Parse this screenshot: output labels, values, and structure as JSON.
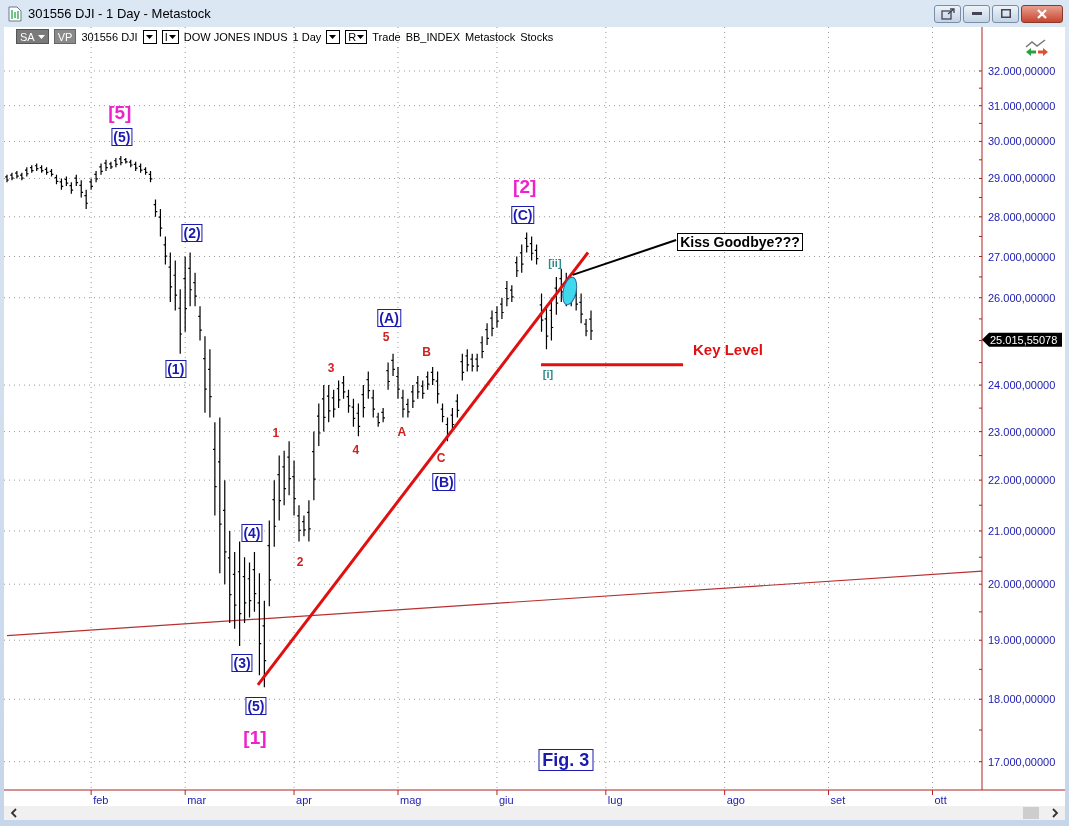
{
  "window": {
    "title": "301556 DJI - 1 Day - Metastock"
  },
  "toolbar": [
    {
      "kind": "combo",
      "label": "SA"
    },
    {
      "kind": "chip",
      "label": "VP"
    },
    {
      "kind": "text",
      "label": "301556 DJI"
    },
    {
      "kind": "dropdown"
    },
    {
      "kind": "dropdown",
      "label": "I"
    },
    {
      "kind": "text",
      "label": "DOW JONES INDUS"
    },
    {
      "kind": "text",
      "label": "1 Day"
    },
    {
      "kind": "dropdown"
    },
    {
      "kind": "dropdown",
      "label": "R"
    },
    {
      "kind": "text",
      "label": "Trade"
    },
    {
      "kind": "text",
      "label": "BB_INDEX"
    },
    {
      "kind": "text",
      "label": "Metastock"
    },
    {
      "kind": "text",
      "label": "Stocks"
    }
  ],
  "chart": {
    "last_price_label": "25.015,55078",
    "y_axis_labels": [
      "32.000,00000",
      "31.000,00000",
      "30.000,00000",
      "29.000,00000",
      "28.000,00000",
      "27.000,00000",
      "26.000,00000",
      "24.000,00000",
      "23.000,00000",
      "22.000,00000",
      "21.000,00000",
      "20.000,00000",
      "19.000,00000",
      "18.000,00000",
      "17.000,00000"
    ],
    "x_axis_labels": [
      "feb",
      "mar",
      "apr",
      "mag",
      "giu",
      "lug",
      "ago",
      "set",
      "ott"
    ],
    "wave_labels": [
      {
        "kind": "major",
        "text": "[5]"
      },
      {
        "kind": "boxed",
        "text": "(5)"
      },
      {
        "kind": "boxed",
        "text": "(2)"
      },
      {
        "kind": "boxed",
        "text": "(1)"
      },
      {
        "kind": "boxed",
        "text": "(4)"
      },
      {
        "kind": "boxed",
        "text": "(3)"
      },
      {
        "kind": "boxed",
        "text": "(5)"
      },
      {
        "kind": "major",
        "text": "[1]"
      },
      {
        "kind": "minor",
        "text": "1"
      },
      {
        "kind": "minor",
        "text": "2"
      },
      {
        "kind": "minor",
        "text": "3"
      },
      {
        "kind": "minor",
        "text": "4"
      },
      {
        "kind": "minor",
        "text": "5"
      },
      {
        "kind": "boxed",
        "text": "(A)"
      },
      {
        "kind": "minor",
        "text": "A"
      },
      {
        "kind": "minor",
        "text": "B"
      },
      {
        "kind": "minor",
        "text": "C"
      },
      {
        "kind": "boxed",
        "text": "(B)"
      },
      {
        "kind": "major",
        "text": "[2]"
      },
      {
        "kind": "boxed",
        "text": "(C)"
      },
      {
        "kind": "sub",
        "text": "[ii]"
      },
      {
        "kind": "sub",
        "text": "[i]"
      }
    ],
    "callout": "Kiss Goodbye???",
    "key_level_label": "Key Level",
    "figure_label": "Fig. 3"
  }
}
